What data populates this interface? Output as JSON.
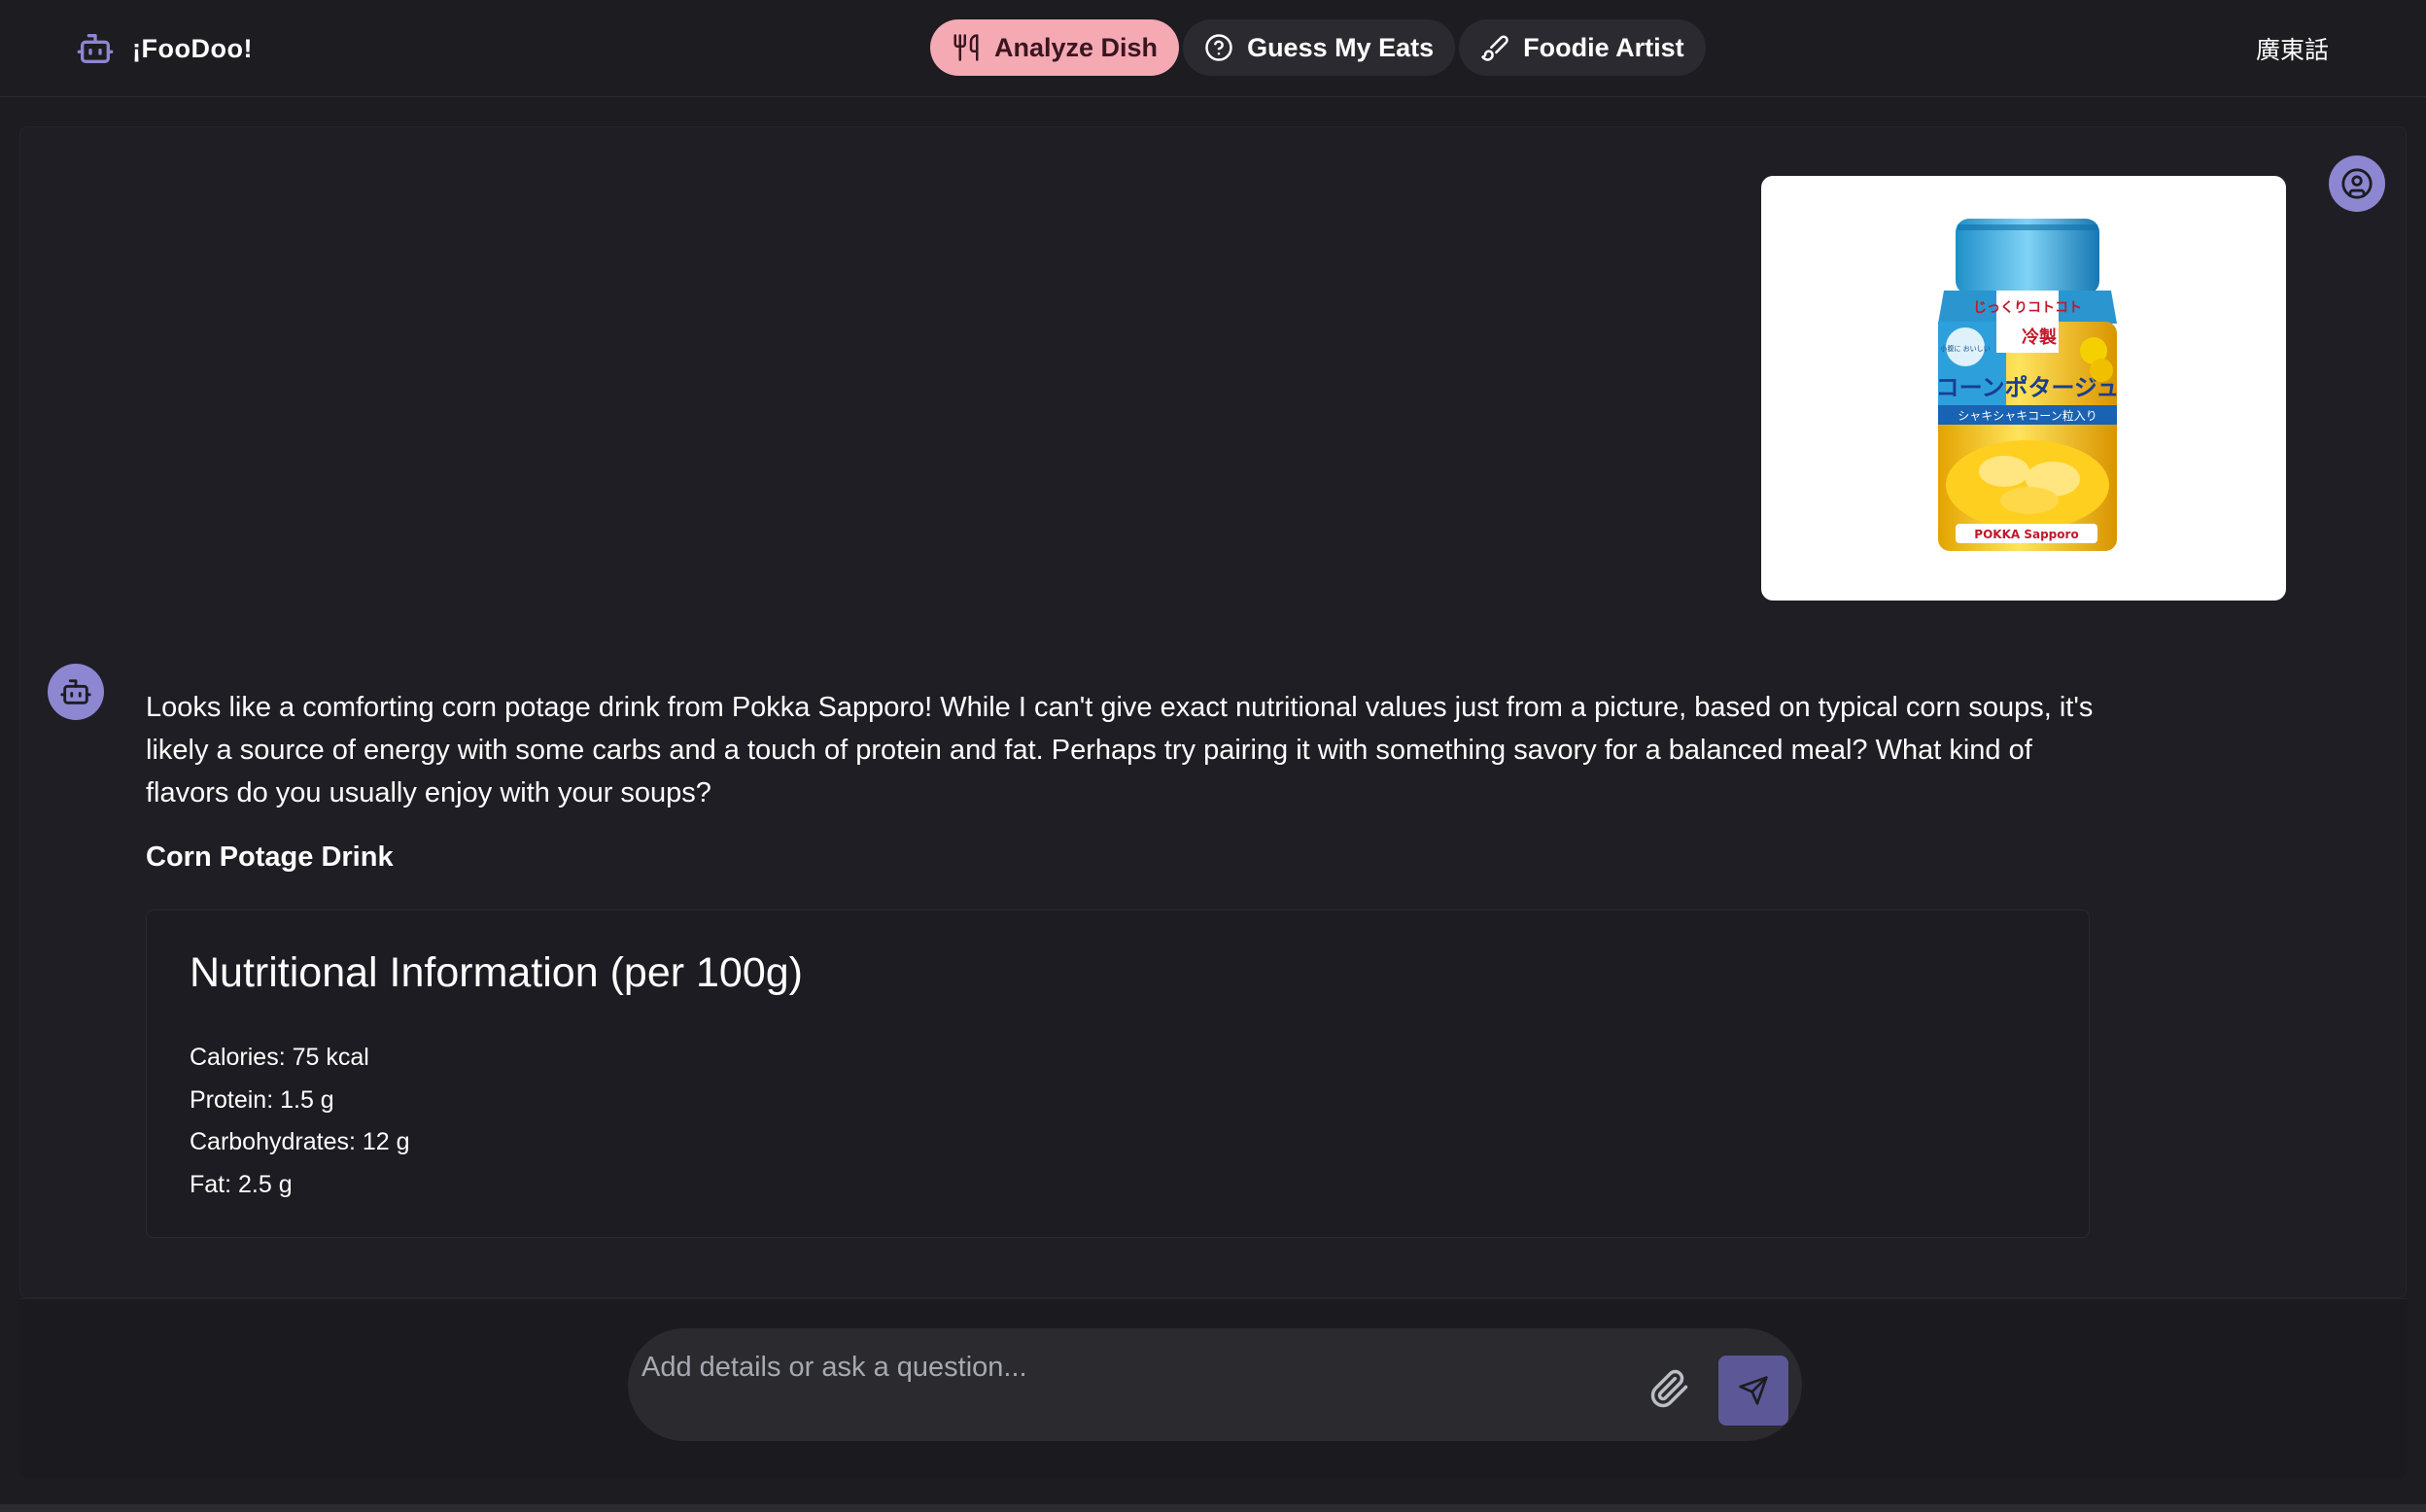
{
  "header": {
    "brand_title": "¡FooDoo!",
    "tabs": [
      {
        "label": "Analyze Dish",
        "icon": "utensils-icon",
        "active": true
      },
      {
        "label": "Guess My Eats",
        "icon": "question-circle-icon",
        "active": false
      },
      {
        "label": "Foodie Artist",
        "icon": "brush-icon",
        "active": false
      }
    ],
    "language": "廣東話"
  },
  "chat": {
    "user_image": {
      "label_top": "じっくりコトコト",
      "label_badge": "冷製",
      "label_side": "小腹に おいしい",
      "label_main": "コーンポタージュ",
      "label_sub": "シャキシャキコーン粒入り",
      "brand": "POKKA Sapporo"
    },
    "bot_message": {
      "text": "Looks like a comforting corn potage drink from Pokka Sapporo! While I can't give exact nutritional values just from a picture, based on typical corn soups, it's likely a source of energy with some carbs and a touch of protein and fat. Perhaps try pairing it with something savory for a balanced meal? What kind of flavors do you usually enjoy with your soups?",
      "dish_name": "Corn Potage Drink",
      "nutrition": {
        "title": "Nutritional Information (per 100g)",
        "items": [
          "Calories: 75 kcal",
          "Protein: 1.5 g",
          "Carbohydrates: 12 g",
          "Fat: 2.5 g"
        ]
      }
    }
  },
  "composer": {
    "placeholder": "Add details or ask a question..."
  },
  "colors": {
    "background": "#1c1c21",
    "active_tab": "#f4a9b3",
    "avatar": "#8d86d1",
    "send_button": "#5c5898"
  }
}
